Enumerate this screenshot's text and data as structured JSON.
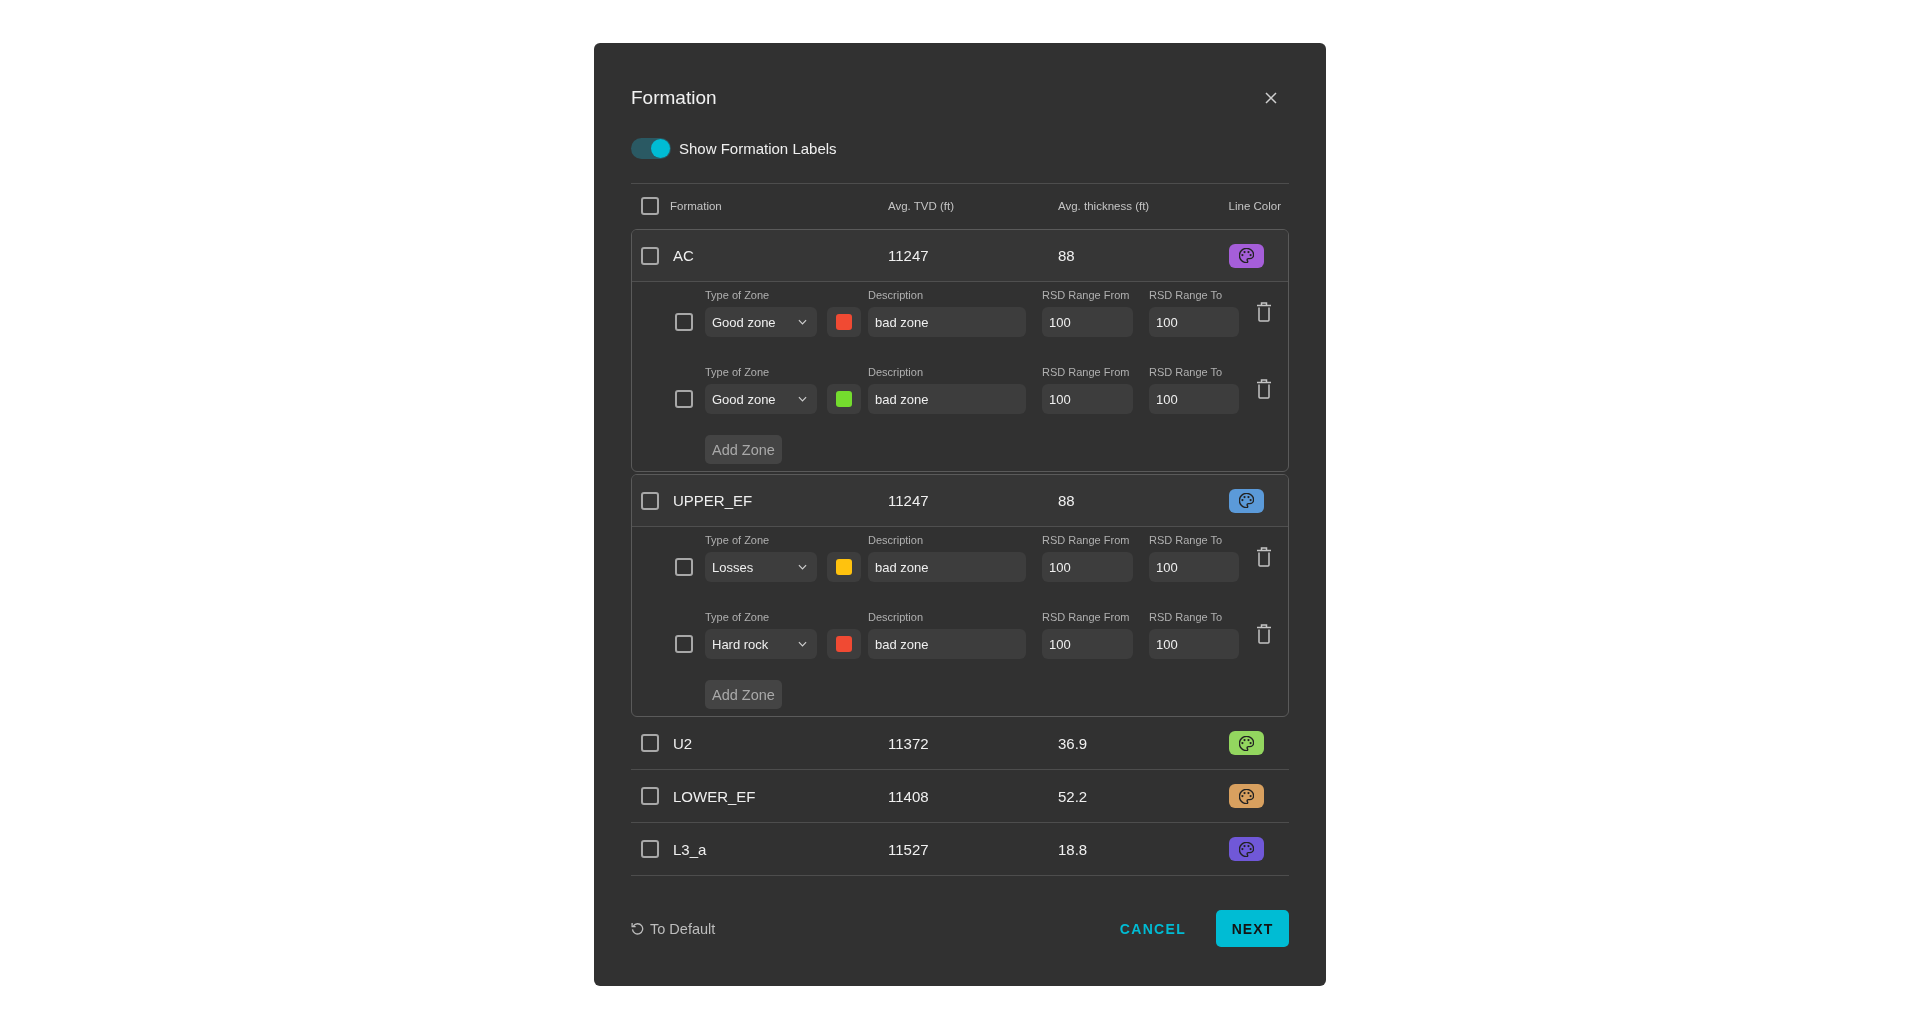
{
  "dialog": {
    "title": "Formation"
  },
  "show_labels_toggle": {
    "label": "Show Formation Labels",
    "on": true
  },
  "table": {
    "select_all_checked": false,
    "columns": [
      "Formation",
      "Avg. TVD (ft)",
      "Avg. thickness (ft)",
      "Line Color"
    ],
    "rows": [
      {
        "name": "AC",
        "avg_tvd": "11247",
        "avg_thickness": "88",
        "color": "#a55ed9",
        "checked": false,
        "expanded": true,
        "zones": [
          {
            "checked": false,
            "type_label": "Type of Zone",
            "type": "Good zone",
            "color": "#f04a33",
            "description_label": "Description",
            "description": "bad zone",
            "rsd_from_label": "RSD Range From",
            "rsd_from": "100",
            "rsd_to_label": "RSD Range To",
            "rsd_to": "100"
          },
          {
            "checked": false,
            "type_label": "Type of Zone",
            "type": "Good zone",
            "color": "#74dc2e",
            "description_label": "Description",
            "description": "bad zone",
            "rsd_from_label": "RSD Range From",
            "rsd_from": "100",
            "rsd_to_label": "RSD Range To",
            "rsd_to": "100"
          }
        ],
        "add_zone_button": "Add Zone"
      },
      {
        "name": "UPPER_EF",
        "avg_tvd": "11247",
        "avg_thickness": "88",
        "color": "#5b9ad9",
        "checked": false,
        "expanded": true,
        "zones": [
          {
            "checked": false,
            "type_label": "Type of Zone",
            "type": "Losses",
            "color": "#ffc20e",
            "description_label": "Description",
            "description": "bad zone",
            "rsd_from_label": "RSD Range From",
            "rsd_from": "100",
            "rsd_to_label": "RSD Range To",
            "rsd_to": "100"
          },
          {
            "checked": false,
            "type_label": "Type of Zone",
            "type": "Hard rock",
            "color": "#f04a33",
            "description_label": "Description",
            "description": "bad zone",
            "rsd_from_label": "RSD Range From",
            "rsd_from": "100",
            "rsd_to_label": "RSD Range To",
            "rsd_to": "100"
          }
        ],
        "add_zone_button": "Add Zone"
      },
      {
        "name": "U2",
        "avg_tvd": "11372",
        "avg_thickness": "36.9",
        "color": "#93d65f",
        "checked": false,
        "expanded": false
      },
      {
        "name": "LOWER_EF",
        "avg_tvd": "11408",
        "avg_thickness": "52.2",
        "color": "#d8a05f",
        "checked": false,
        "expanded": false
      },
      {
        "name": "L3_a",
        "avg_tvd": "11527",
        "avg_thickness": "18.8",
        "color": "#7058d8",
        "checked": false,
        "expanded": false
      }
    ]
  },
  "footer": {
    "reset_button": "To Default",
    "cancel_button": "CANCEL",
    "next_button": "NEXT"
  }
}
